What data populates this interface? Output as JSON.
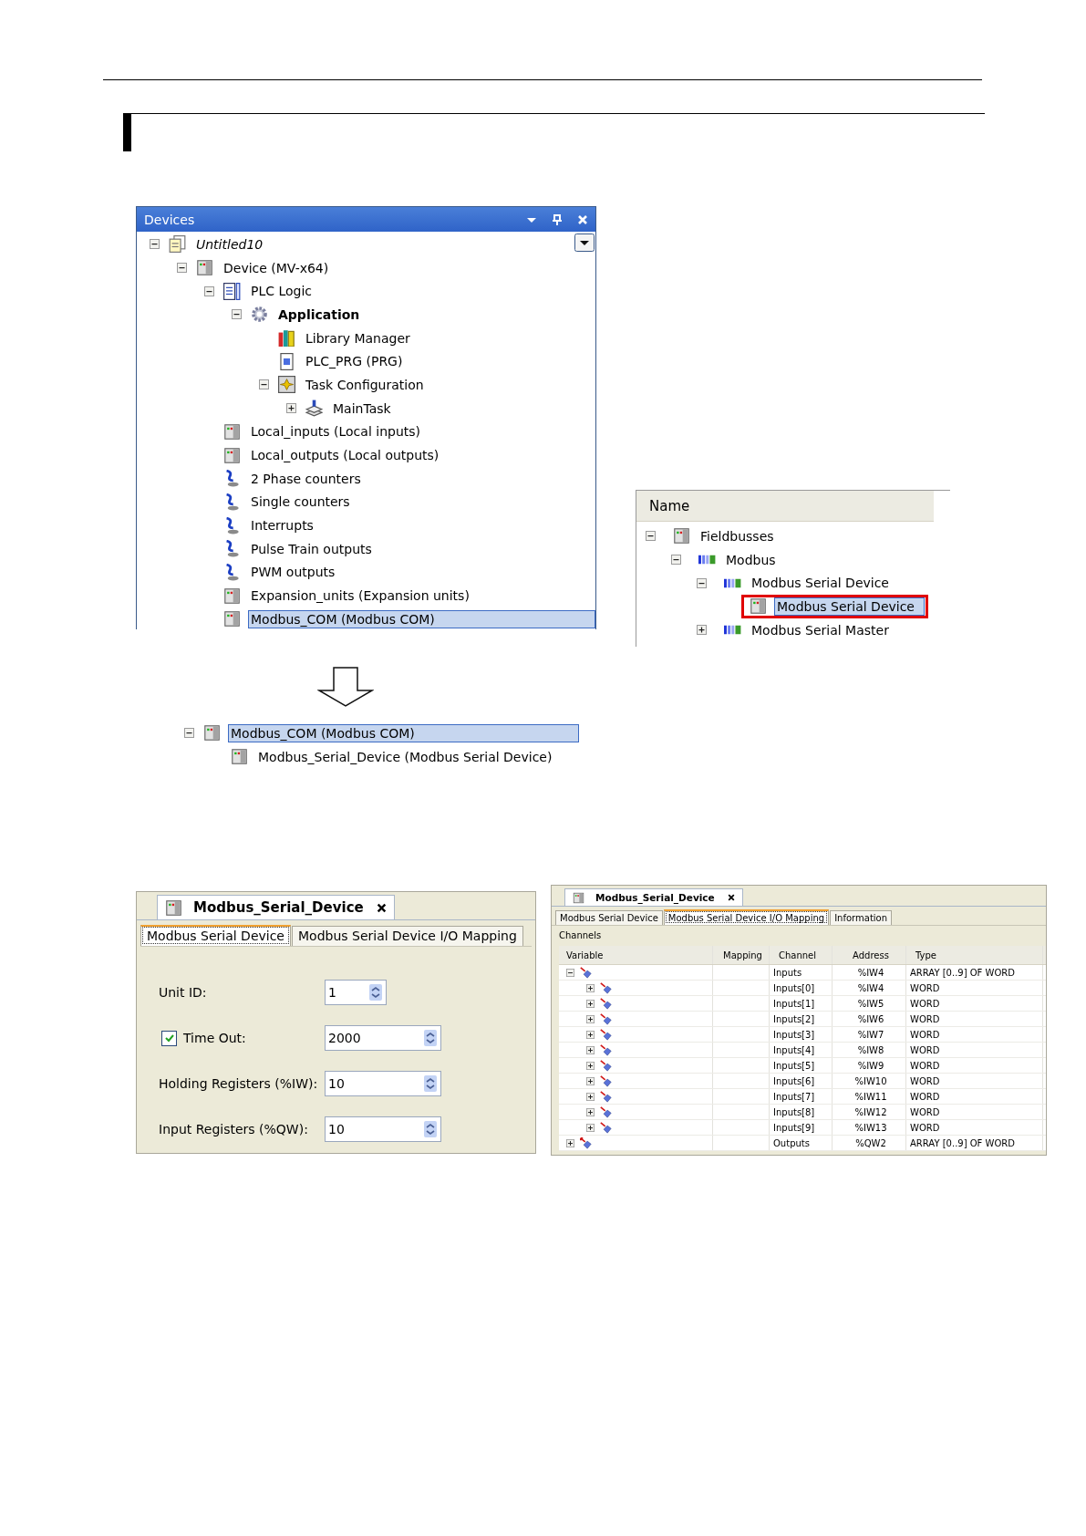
{
  "devices": {
    "title": "Devices",
    "tree": [
      {
        "label": "Untitled10",
        "kind": "project",
        "expanded": true,
        "selected": false,
        "children": [
          {
            "label": "Device (MV-x64)",
            "kind": "device",
            "expanded": true,
            "selected": false,
            "children": [
              {
                "label": "PLC Logic",
                "kind": "plc-logic",
                "expanded": true,
                "selected": false,
                "children": [
                  {
                    "label": "Application",
                    "kind": "application",
                    "expanded": true,
                    "selected": false,
                    "children": [
                      {
                        "label": "Library Manager",
                        "kind": "library",
                        "selected": false
                      },
                      {
                        "label": "PLC_PRG (PRG)",
                        "kind": "pou",
                        "selected": false
                      },
                      {
                        "label": "Task Configuration",
                        "kind": "task-config",
                        "expanded": true,
                        "selected": false,
                        "children": [
                          {
                            "label": "MainTask",
                            "kind": "task",
                            "expanded": false,
                            "selected": false
                          }
                        ]
                      }
                    ]
                  }
                ]
              },
              {
                "label": "Local_inputs (Local inputs)",
                "kind": "device",
                "selected": false
              },
              {
                "label": "Local_outputs (Local outputs)",
                "kind": "device",
                "selected": false
              },
              {
                "label": "2 Phase counters",
                "kind": "counter",
                "selected": false
              },
              {
                "label": "Single counters",
                "kind": "counter",
                "selected": false
              },
              {
                "label": "Interrupts",
                "kind": "counter",
                "selected": false
              },
              {
                "label": "Pulse Train outputs",
                "kind": "counter",
                "selected": false
              },
              {
                "label": "PWM outputs",
                "kind": "counter",
                "selected": false
              },
              {
                "label": "Expansion_units (Expansion units)",
                "kind": "device",
                "selected": false
              },
              {
                "label": "Modbus_COM (Modbus COM)",
                "kind": "device",
                "selected": true
              }
            ]
          }
        ]
      }
    ]
  },
  "catalog": {
    "header": "Name",
    "tree": [
      {
        "label": "Fieldbusses",
        "kind": "device",
        "expanded": true,
        "selected": false,
        "children": [
          {
            "label": "Modbus",
            "kind": "modbus",
            "expanded": true,
            "selected": false,
            "children": [
              {
                "label": "Modbus Serial Device",
                "kind": "modbus",
                "expanded": true,
                "selected": false,
                "children": [
                  {
                    "label": "Modbus Serial Device",
                    "kind": "device",
                    "selected": true,
                    "marked": true
                  }
                ]
              },
              {
                "label": "Modbus Serial Master",
                "kind": "modbus",
                "expanded": false,
                "selected": false
              }
            ]
          }
        ]
      }
    ]
  },
  "result_tree": [
    {
      "label": "Modbus_COM (Modbus COM)",
      "kind": "device",
      "expanded": true,
      "selected": true,
      "children": [
        {
          "label": "Modbus_Serial_Device (Modbus Serial Device)",
          "kind": "device",
          "selected": false
        }
      ]
    }
  ],
  "settings_editor": {
    "title": "Modbus_Serial_Device",
    "tabs": [
      {
        "label": "Modbus Serial Device",
        "selected": true
      },
      {
        "label": "Modbus Serial Device I/O Mapping",
        "selected": false
      }
    ],
    "fields": [
      {
        "label": "Unit ID:",
        "value": "1",
        "kind": "short"
      },
      {
        "label": "Time Out:",
        "value": "2000",
        "kind": "long",
        "checked": true
      },
      {
        "label": "Holding Registers (%IW):",
        "value": "10",
        "kind": "long"
      },
      {
        "label": "Input Registers (%QW):",
        "value": "10",
        "kind": "long"
      }
    ]
  },
  "mapping_editor": {
    "title": "Modbus_Serial_Device",
    "tabs": [
      {
        "label": "Modbus Serial Device",
        "selected": false
      },
      {
        "label": "Modbus Serial Device I/O Mapping",
        "selected": true
      },
      {
        "label": "Information",
        "selected": false
      }
    ],
    "section": "Channels",
    "columns": [
      "Variable",
      "Mapping",
      "Channel",
      "Address",
      "Type"
    ],
    "rows": [
      {
        "kind": "input",
        "expanded": true,
        "channel": "Inputs",
        "address": "%IW4",
        "type": "ARRAY [0..9] OF WORD",
        "children": [
          {
            "kind": "input",
            "expanded": false,
            "channel": "Inputs[0]",
            "address": "%IW4",
            "type": "WORD"
          },
          {
            "kind": "input",
            "expanded": false,
            "channel": "Inputs[1]",
            "address": "%IW5",
            "type": "WORD"
          },
          {
            "kind": "input",
            "expanded": false,
            "channel": "Inputs[2]",
            "address": "%IW6",
            "type": "WORD"
          },
          {
            "kind": "input",
            "expanded": false,
            "channel": "Inputs[3]",
            "address": "%IW7",
            "type": "WORD"
          },
          {
            "kind": "input",
            "expanded": false,
            "channel": "Inputs[4]",
            "address": "%IW8",
            "type": "WORD"
          },
          {
            "kind": "input",
            "expanded": false,
            "channel": "Inputs[5]",
            "address": "%IW9",
            "type": "WORD"
          },
          {
            "kind": "input",
            "expanded": false,
            "channel": "Inputs[6]",
            "address": "%IW10",
            "type": "WORD"
          },
          {
            "kind": "input",
            "expanded": false,
            "channel": "Inputs[7]",
            "address": "%IW11",
            "type": "WORD"
          },
          {
            "kind": "input",
            "expanded": false,
            "channel": "Inputs[8]",
            "address": "%IW12",
            "type": "WORD"
          },
          {
            "kind": "input",
            "expanded": false,
            "channel": "Inputs[9]",
            "address": "%IW13",
            "type": "WORD"
          }
        ]
      },
      {
        "kind": "output",
        "expanded": false,
        "channel": "Outputs",
        "address": "%QW2",
        "type": "ARRAY [0..9] OF WORD"
      }
    ]
  }
}
